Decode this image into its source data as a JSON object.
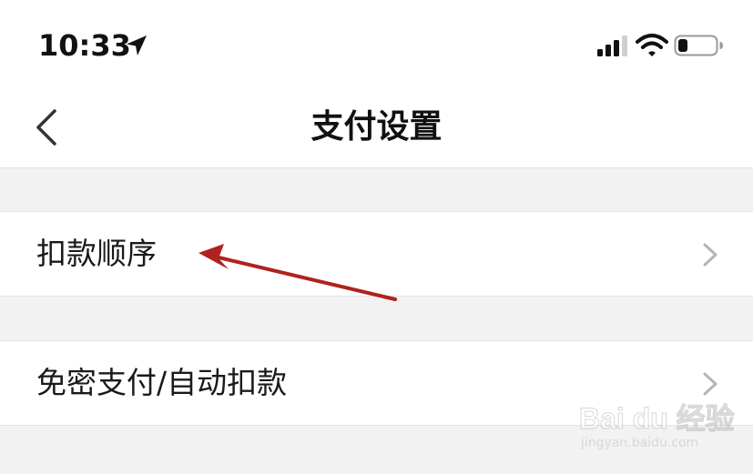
{
  "status_bar": {
    "time": "10:33",
    "icons": [
      "location-arrow-icon",
      "signal-icon",
      "wifi-icon",
      "battery-icon"
    ],
    "battery_level": 0.25
  },
  "header": {
    "title": "支付设置",
    "back_icon": "chevron-left-icon"
  },
  "settings_list": [
    {
      "label": "扣款顺序",
      "icon": "chevron-right-icon"
    },
    {
      "label": "免密支付/自动扣款",
      "icon": "chevron-right-icon"
    }
  ],
  "annotation": {
    "type": "arrow",
    "color": "#b0221e",
    "target": "扣款顺序"
  },
  "watermark": {
    "brand": "Bai du 经验",
    "site": "jingyan.baidu.com"
  },
  "colors": {
    "background": "#f2f2f2",
    "surface": "#ffffff",
    "text": "#1a1a1a",
    "chevron": "#b5b5b5",
    "arrow": "#b0221e"
  }
}
